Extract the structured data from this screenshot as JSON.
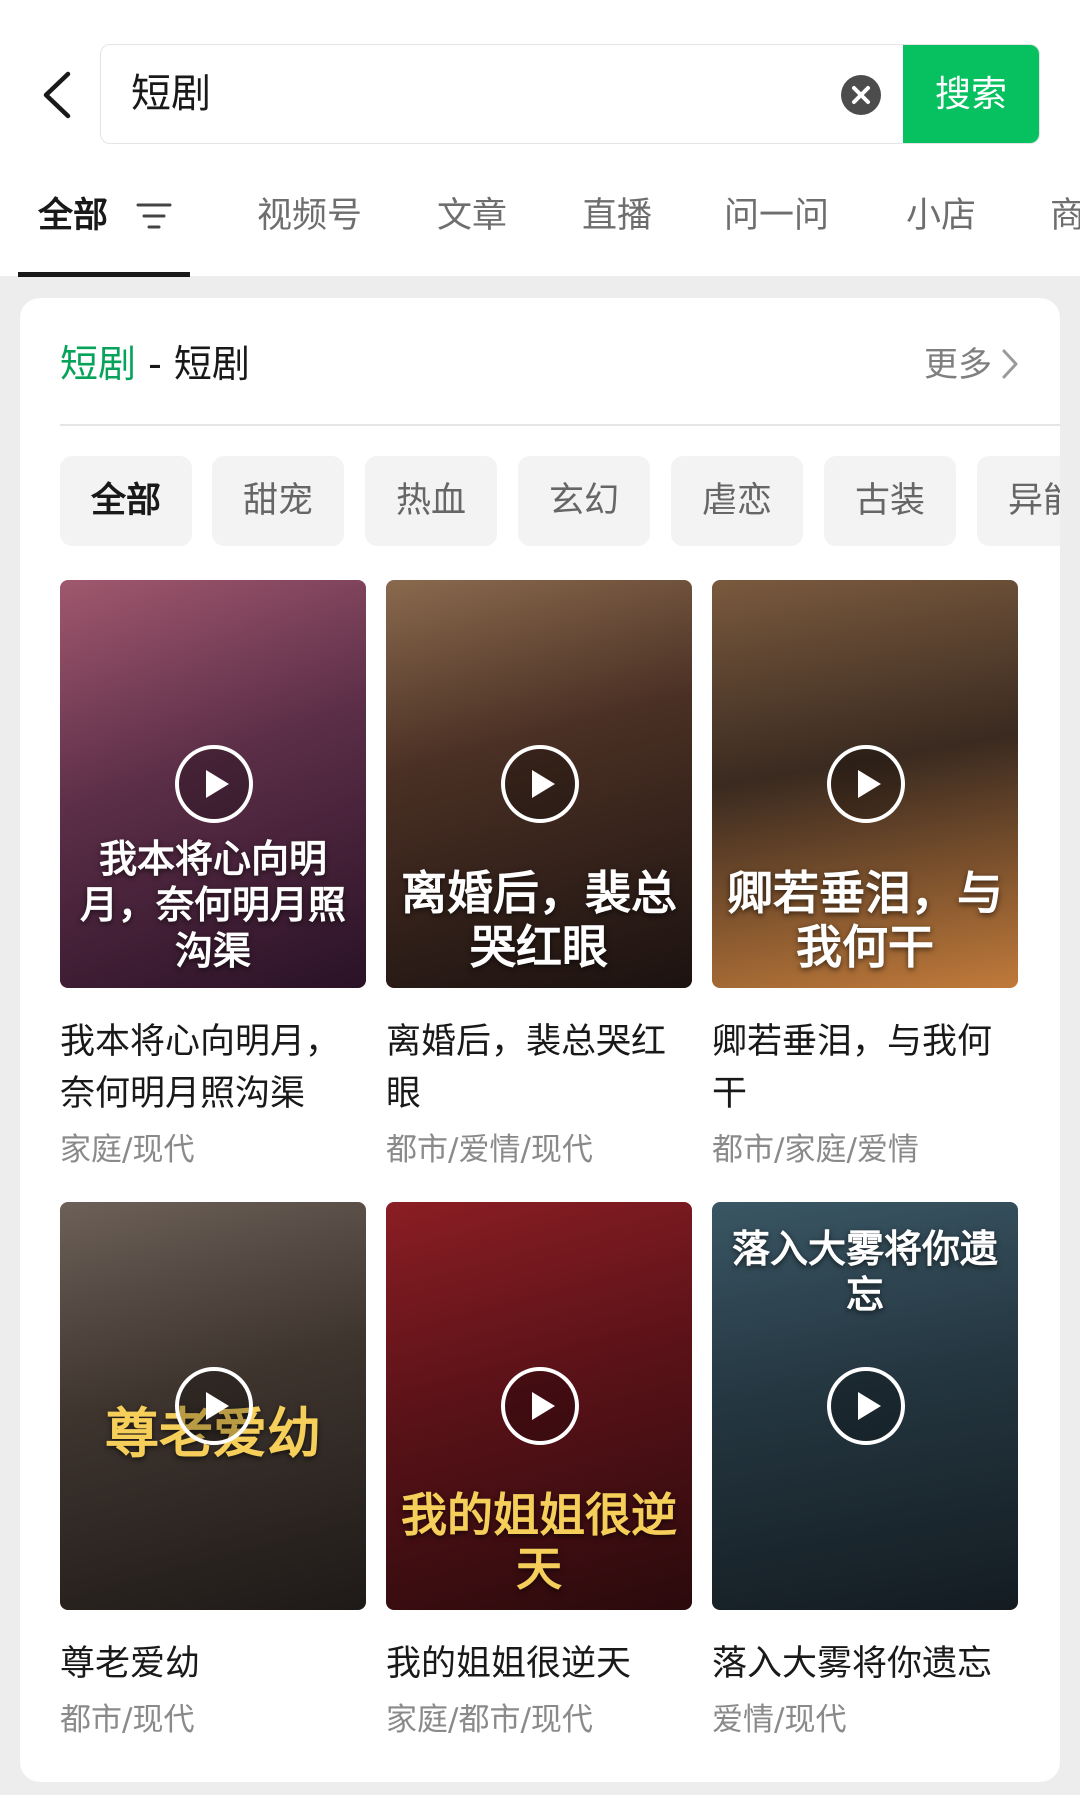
{
  "search": {
    "query": "短剧",
    "button_label": "搜索"
  },
  "tabs": [
    "全部",
    "视频号",
    "文章",
    "直播",
    "问一问",
    "小店",
    "商"
  ],
  "card": {
    "heading_highlight": "短剧",
    "heading_rest": " - 短剧",
    "more_label": "更多"
  },
  "genres": [
    "全部",
    "甜宠",
    "热血",
    "玄幻",
    "虐恋",
    "古装",
    "异能"
  ],
  "dramas": [
    {
      "title": "我本将心向明月，奈何明月照沟渠",
      "tags": "家庭/现代",
      "poster_text": "我本将心向明月，奈何明月照沟渠"
    },
    {
      "title": "离婚后，裴总哭红眼",
      "tags": "都市/爱情/现代",
      "poster_text": "离婚后，裴总哭红眼"
    },
    {
      "title": "卿若垂泪，与我何干",
      "tags": "都市/家庭/爱情",
      "poster_text": "卿若垂泪，与我何干"
    },
    {
      "title": "尊老爱幼",
      "tags": "都市/现代",
      "poster_text": "尊老爱幼"
    },
    {
      "title": "我的姐姐很逆天",
      "tags": "家庭/都市/现代",
      "poster_text": "我的姐姐很逆天"
    },
    {
      "title": "落入大雾将你遗忘",
      "tags": "爱情/现代",
      "poster_text": "落入大雾将你遗忘"
    }
  ],
  "icons": {
    "back": "chevron-left-icon",
    "clear": "clear-circle-icon",
    "filter": "filter-icon",
    "more": "chevron-right-icon",
    "play": "play-circle-icon"
  },
  "colors": {
    "accent": "#07c160",
    "highlight_text": "#07a35a"
  }
}
